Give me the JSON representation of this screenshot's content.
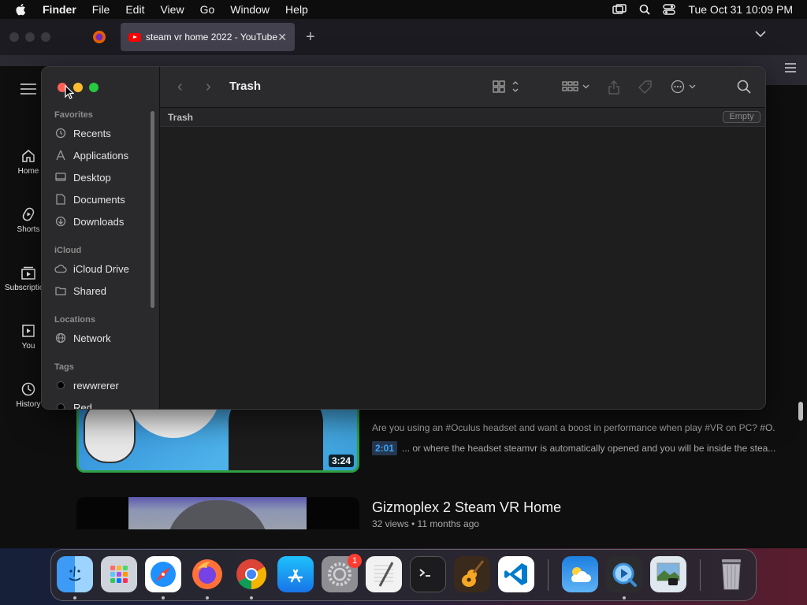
{
  "menubar": {
    "app_name": "Finder",
    "items": [
      "File",
      "Edit",
      "View",
      "Go",
      "Window",
      "Help"
    ],
    "datetime": "Tue Oct 31  10:09 PM"
  },
  "browser": {
    "tab_title": "steam vr home 2022 - YouTube"
  },
  "youtube": {
    "nav": [
      {
        "label": "Home",
        "icon": "home-icon"
      },
      {
        "label": "Shorts",
        "icon": "shorts-icon"
      },
      {
        "label": "Subscriptions",
        "icon": "subscriptions-icon"
      },
      {
        "label": "You",
        "icon": "library-icon"
      },
      {
        "label": "History",
        "icon": "history-icon"
      }
    ],
    "video1": {
      "duration": "3:24",
      "description": "Are you using an #Oculus headset and want a boost in performance when play #VR on PC? #O...",
      "chapter_time": "2:01",
      "chapter_text": "... or where the headset steamvr is automatically opened and you will be inside the stea..."
    },
    "video2": {
      "title": "Gizmoplex 2 Steam VR Home",
      "meta": "32 views • 11 months ago"
    }
  },
  "finder": {
    "title": "Trash",
    "path_label": "Trash",
    "empty_button": "Empty",
    "sections": {
      "favorites": "Favorites",
      "icloud": "iCloud",
      "locations": "Locations",
      "tags": "Tags"
    },
    "favorites": [
      "Recents",
      "Applications",
      "Desktop",
      "Documents",
      "Downloads"
    ],
    "icloud": [
      "iCloud Drive",
      "Shared"
    ],
    "locations": [
      "Network"
    ],
    "tags": [
      "rewwrerer",
      "Red"
    ]
  },
  "dock": {
    "apps": [
      "Finder",
      "Launchpad",
      "Safari",
      "Firefox",
      "Chrome",
      "App Store",
      "System Settings",
      "TextEdit",
      "Terminal",
      "GarageBand",
      "Visual Studio Code",
      "Weather",
      "QuickTime Player",
      "Preview",
      "Trash"
    ],
    "settings_badge": "1"
  },
  "colors": {
    "close": "#ff5f57",
    "minimize": "#febc2e",
    "zoom": "#28c840",
    "youtube_red": "#ff0000",
    "chapter_link": "#3ea6ff"
  }
}
